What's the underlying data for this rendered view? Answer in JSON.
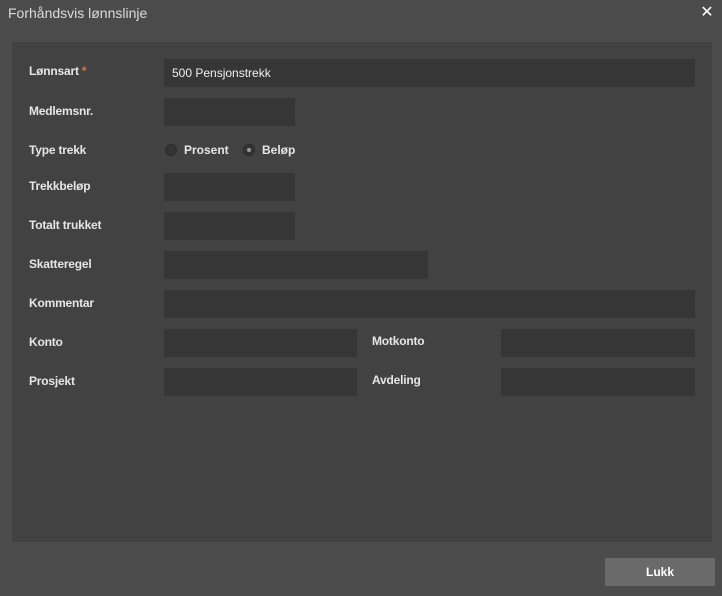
{
  "dialog": {
    "title": "Forhåndsvis lønnslinje",
    "close_icon": "close-icon",
    "close_glyph": "✕"
  },
  "form": {
    "lonnsart": {
      "label": "Lønnsart",
      "required_mark": "*",
      "value": "500 Pensjonstrekk"
    },
    "medlemsnr": {
      "label": "Medlemsnr.",
      "value": ""
    },
    "type_trekk": {
      "label": "Type trekk",
      "options": [
        {
          "label": "Prosent",
          "selected": false
        },
        {
          "label": "Beløp",
          "selected": true
        }
      ]
    },
    "trekkbelop": {
      "label": "Trekkbeløp",
      "value": ""
    },
    "totalt_trukket": {
      "label": "Totalt trukket",
      "value": ""
    },
    "skatteregel": {
      "label": "Skatteregel",
      "value": ""
    },
    "kommentar": {
      "label": "Kommentar",
      "value": ""
    },
    "konto": {
      "label": "Konto",
      "value": ""
    },
    "motkonto": {
      "label": "Motkonto",
      "value": ""
    },
    "prosjekt": {
      "label": "Prosjekt",
      "value": ""
    },
    "avdeling": {
      "label": "Avdeling",
      "value": ""
    }
  },
  "footer": {
    "close_button_label": "Lukk"
  },
  "colors": {
    "background": "#4b4b4b",
    "panel": "#424242",
    "field": "#363636",
    "required": "#e07a2e",
    "button": "#6a6a6a"
  }
}
